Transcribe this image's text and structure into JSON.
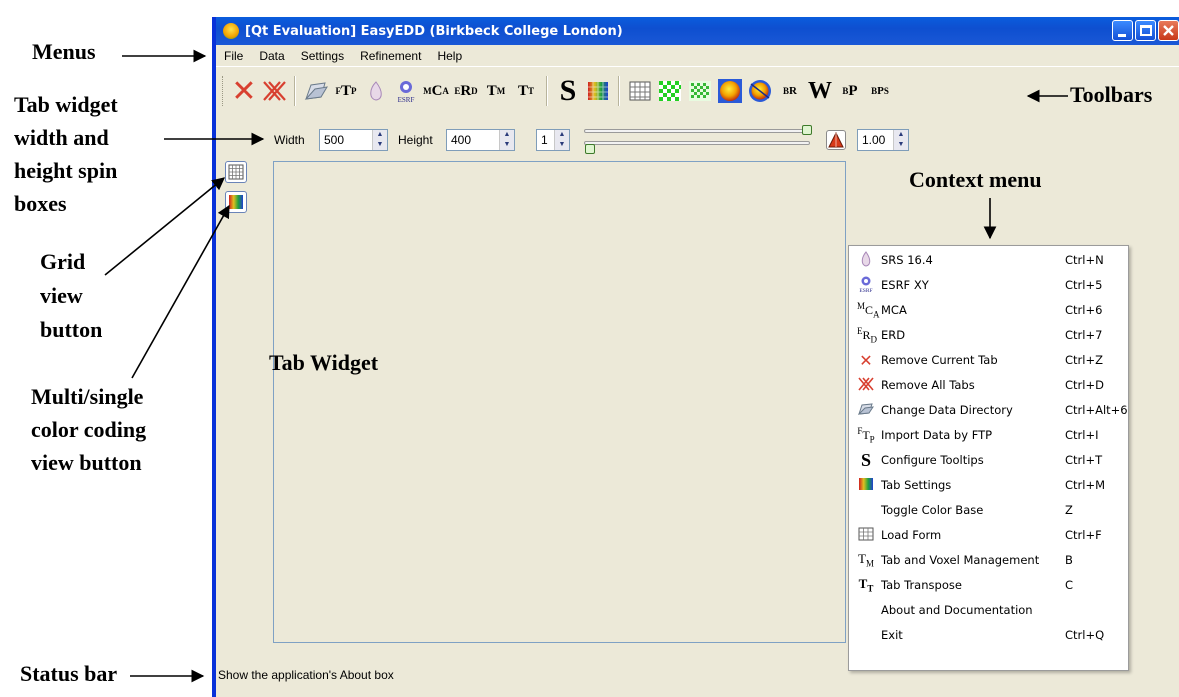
{
  "window": {
    "title": "[Qt Evaluation] EasyEDD (Birkbeck College London)",
    "icon": "app-sphere-icon"
  },
  "menubar": [
    "File",
    "Data",
    "Settings",
    "Refinement",
    "Help"
  ],
  "toolbar": {
    "buttons": [
      {
        "icon": "remove-current-tab-icon",
        "glyph": "X"
      },
      {
        "icon": "remove-all-tabs-icon",
        "glyph": "X"
      },
      {
        "icon": "change-data-directory-icon"
      },
      {
        "icon": "import-data-ftp-icon",
        "glyph": "FTP"
      },
      {
        "icon": "srs-icon"
      },
      {
        "icon": "esrf-xy-icon"
      },
      {
        "icon": "mca-icon",
        "glyph": "MCA"
      },
      {
        "icon": "erd-icon",
        "glyph": "ERD"
      },
      {
        "icon": "tab-voxel-management-icon",
        "glyph": "TM"
      },
      {
        "icon": "tab-transpose-icon",
        "glyph": "TT"
      },
      {
        "icon": "configure-tooltips-icon",
        "glyph": "S"
      },
      {
        "icon": "tab-settings-icon"
      },
      {
        "icon": "grid-icon"
      },
      {
        "icon": "green-checker-icon"
      },
      {
        "icon": "green-checker-alt-icon"
      },
      {
        "icon": "sphere-icon"
      },
      {
        "icon": "sphere-striped-icon"
      },
      {
        "icon": "br-icon",
        "glyph": "BR"
      },
      {
        "icon": "w-icon",
        "glyph": "W"
      },
      {
        "icon": "bp-icon",
        "glyph": "BP"
      },
      {
        "icon": "ps-icon",
        "glyph": "BPS"
      }
    ]
  },
  "size_controls": {
    "width_label": "Width",
    "width_value": "500",
    "height_label": "Height",
    "height_value": "400",
    "step_value": "1",
    "scale_value": "1.00"
  },
  "tab_widget": {
    "title": "Tab Widget"
  },
  "status_bar": {
    "text": "Show the application's About box"
  },
  "context_menu": {
    "items": [
      {
        "label": "SRS 16.4",
        "shortcut": "Ctrl+N",
        "icon": "srs-icon"
      },
      {
        "label": "ESRF XY",
        "shortcut": "Ctrl+5",
        "icon": "esrf-icon"
      },
      {
        "label": "MCA",
        "shortcut": "Ctrl+6",
        "icon": "mca-icon"
      },
      {
        "label": "ERD",
        "shortcut": "Ctrl+7",
        "icon": "erd-icon"
      },
      {
        "label": "Remove Current Tab",
        "shortcut": "Ctrl+Z",
        "icon": "remove-current-tab-icon"
      },
      {
        "label": "Remove All Tabs",
        "shortcut": "Ctrl+D",
        "icon": "remove-all-tabs-icon"
      },
      {
        "label": "Change Data Directory",
        "shortcut": "Ctrl+Alt+6",
        "icon": "folder-icon"
      },
      {
        "label": "Import Data by FTP",
        "shortcut": "Ctrl+I",
        "icon": "ftp-icon"
      },
      {
        "label": "Configure Tooltips",
        "shortcut": "Ctrl+T",
        "icon": "tooltip-s-icon"
      },
      {
        "label": "Tab Settings",
        "shortcut": "Ctrl+M",
        "icon": "color-grid-icon"
      },
      {
        "label": "Toggle Color Base",
        "shortcut": "Z",
        "icon": ""
      },
      {
        "label": "Load Form",
        "shortcut": "Ctrl+F",
        "icon": "grid-icon"
      },
      {
        "label": "Tab and Voxel Management",
        "shortcut": "B",
        "icon": "tm-icon"
      },
      {
        "label": "Tab Transpose",
        "shortcut": "C",
        "icon": "tt-icon"
      },
      {
        "label": "About and Documentation",
        "shortcut": "",
        "icon": ""
      },
      {
        "label": "Exit",
        "shortcut": "Ctrl+Q",
        "icon": ""
      }
    ]
  },
  "annotations": {
    "menus": "Menus",
    "toolbars": "Toolbars",
    "spin_boxes": [
      "Tab widget",
      "width and",
      "height spin",
      "boxes"
    ],
    "context_menu": "Context menu",
    "grid_button": [
      "Grid",
      "view",
      "button"
    ],
    "color_button": [
      "Multi/single",
      "color coding",
      "view button"
    ],
    "status_bar": "Status bar"
  },
  "colors": {
    "title_bar": "#0e4fd0",
    "window_bg": "#ece9d8",
    "remove_red": "#d84030"
  }
}
